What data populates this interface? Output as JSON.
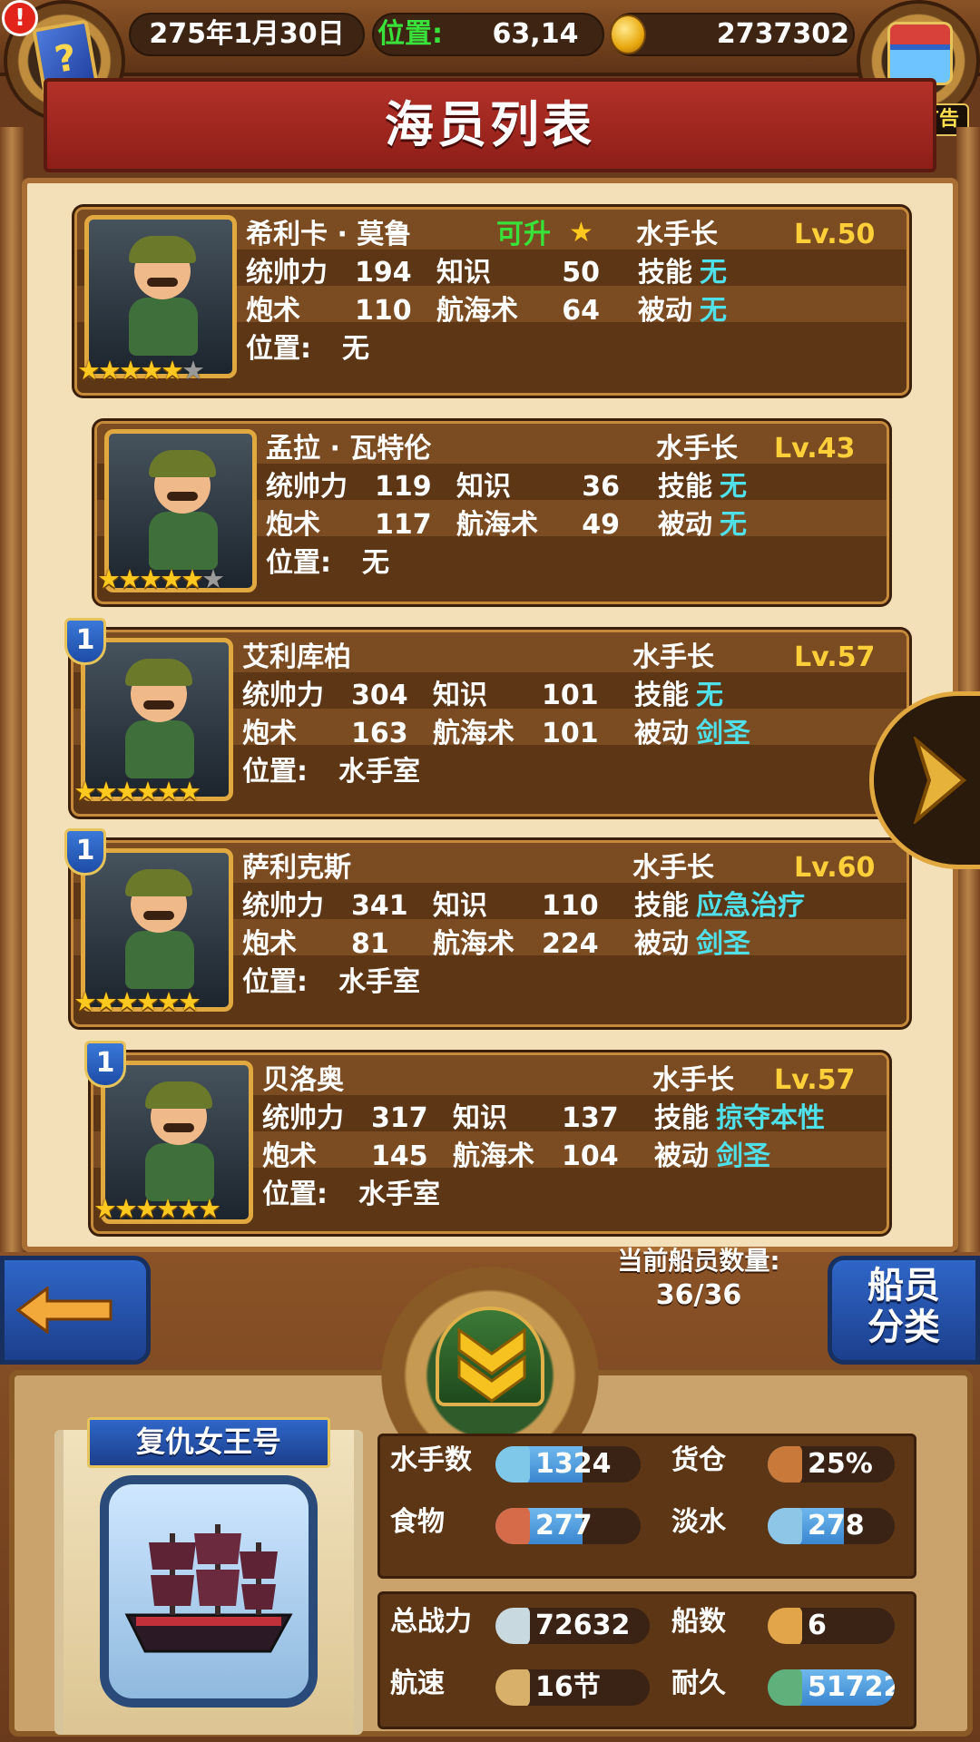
{
  "topbar": {
    "date": "275年1月30日",
    "position_label": "位置:",
    "position_value": "63,14",
    "gold": "2737302",
    "alert_mark": "!",
    "ad_label": "有新广告"
  },
  "title": "海员列表",
  "labels": {
    "command": "统帅力",
    "knowledge": "知识",
    "skill": "技能",
    "gunnery": "炮术",
    "navigation": "航海术",
    "passive": "被动",
    "position": "位置:"
  },
  "crew": [
    {
      "name": "希利卡 · 莫鲁",
      "upgrade": "可升",
      "role": "水手长",
      "level": "Lv.50",
      "command": "194",
      "knowledge": "50",
      "skill": "无",
      "gunnery": "110",
      "navigation": "64",
      "passive": "无",
      "position": "无",
      "stars": 5,
      "max_stars": 6,
      "rank": ""
    },
    {
      "name": "孟拉 · 瓦特伦",
      "upgrade": "",
      "role": "水手长",
      "level": "Lv.43",
      "command": "119",
      "knowledge": "36",
      "skill": "无",
      "gunnery": "117",
      "navigation": "49",
      "passive": "无",
      "position": "无",
      "stars": 5,
      "max_stars": 6,
      "rank": ""
    },
    {
      "name": "艾利库柏",
      "upgrade": "",
      "role": "水手长",
      "level": "Lv.57",
      "command": "304",
      "knowledge": "101",
      "skill": "无",
      "gunnery": "163",
      "navigation": "101",
      "passive": "剑圣",
      "position": "水手室",
      "stars": 6,
      "max_stars": 6,
      "rank": "1"
    },
    {
      "name": "萨利克斯",
      "upgrade": "",
      "role": "水手长",
      "level": "Lv.60",
      "command": "341",
      "knowledge": "110",
      "skill": "应急治疗",
      "gunnery": "81",
      "navigation": "224",
      "passive": "剑圣",
      "position": "水手室",
      "stars": 6,
      "max_stars": 6,
      "rank": "1"
    },
    {
      "name": "贝洛奥",
      "upgrade": "",
      "role": "水手长",
      "level": "Lv.57",
      "command": "317",
      "knowledge": "137",
      "skill": "掠夺本性",
      "gunnery": "145",
      "navigation": "104",
      "passive": "剑圣",
      "position": "水手室",
      "stars": 6,
      "max_stars": 6,
      "rank": "1"
    }
  ],
  "crew_count": {
    "label": "当前船员数量:",
    "value": "36/36"
  },
  "sort_button": "船员\n分类",
  "ship": {
    "name": "复仇女王号",
    "stats": {
      "sailors": {
        "label": "水手数",
        "value": "1324",
        "fill": 0.6
      },
      "cargo": {
        "label": "货仓",
        "value": "25%",
        "fill": 0.25
      },
      "food": {
        "label": "食物",
        "value": "277",
        "fill": 0.6
      },
      "water": {
        "label": "淡水",
        "value": "278",
        "fill": 0.6
      },
      "power": {
        "label": "总战力",
        "value": "72632",
        "fill": 0
      },
      "ships": {
        "label": "船数",
        "value": "6",
        "fill": 0
      },
      "speed": {
        "label": "航速",
        "value": "16节",
        "fill": 0
      },
      "durability": {
        "label": "耐久",
        "value": "51722",
        "fill": 1.0
      }
    }
  },
  "colors": {
    "accent_blue": "#2f66c8",
    "skill_cyan": "#4fe0ea",
    "level_gold": "#ffcf3a",
    "upgrade_green": "#39e23a",
    "title_red": "#b33128"
  }
}
